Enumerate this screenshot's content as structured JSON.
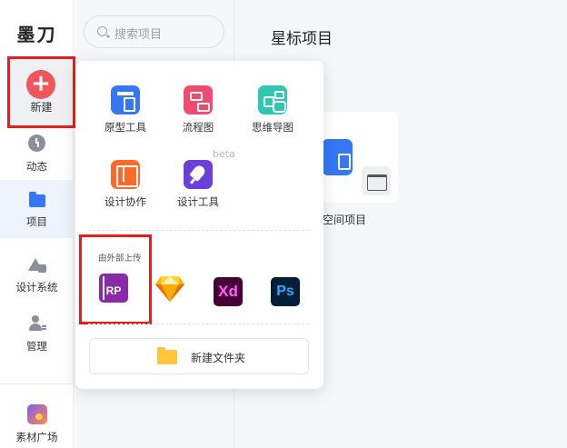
{
  "brand": "墨刀",
  "rail": {
    "new_label": "新建",
    "items": [
      {
        "label": "动态",
        "icon": "clock-icon"
      },
      {
        "label": "项目",
        "icon": "folder-icon"
      },
      {
        "label": "设计系统",
        "icon": "design-system-icon"
      },
      {
        "label": "管理",
        "icon": "manage-icon"
      },
      {
        "label": "素材广场",
        "icon": "market-icon"
      }
    ]
  },
  "search": {
    "placeholder": "搜索项目"
  },
  "main": {
    "title": "星标项目",
    "card_label": "空间项目"
  },
  "popup": {
    "tools": [
      {
        "label": "原型工具",
        "icon": "prototype-icon"
      },
      {
        "label": "流程图",
        "icon": "flowchart-icon"
      },
      {
        "label": "思维导图",
        "icon": "mindmap-icon"
      },
      {
        "label": "设计协作",
        "icon": "design-collab-icon"
      },
      {
        "label": "设计工具",
        "icon": "design-tool-icon"
      }
    ],
    "beta": "beta",
    "upload_title": "由外部上传",
    "apps": [
      {
        "label": "RP",
        "icon": "axure-rp-icon"
      },
      {
        "label": "",
        "icon": "sketch-icon"
      },
      {
        "label": "Xd",
        "icon": "adobe-xd-icon"
      },
      {
        "label": "Ps",
        "icon": "photoshop-icon"
      }
    ],
    "new_folder": "新建文件夹"
  },
  "colors": {
    "accent": "#3478f6",
    "highlight": "#e3201c",
    "new_button": "#f0555a"
  }
}
